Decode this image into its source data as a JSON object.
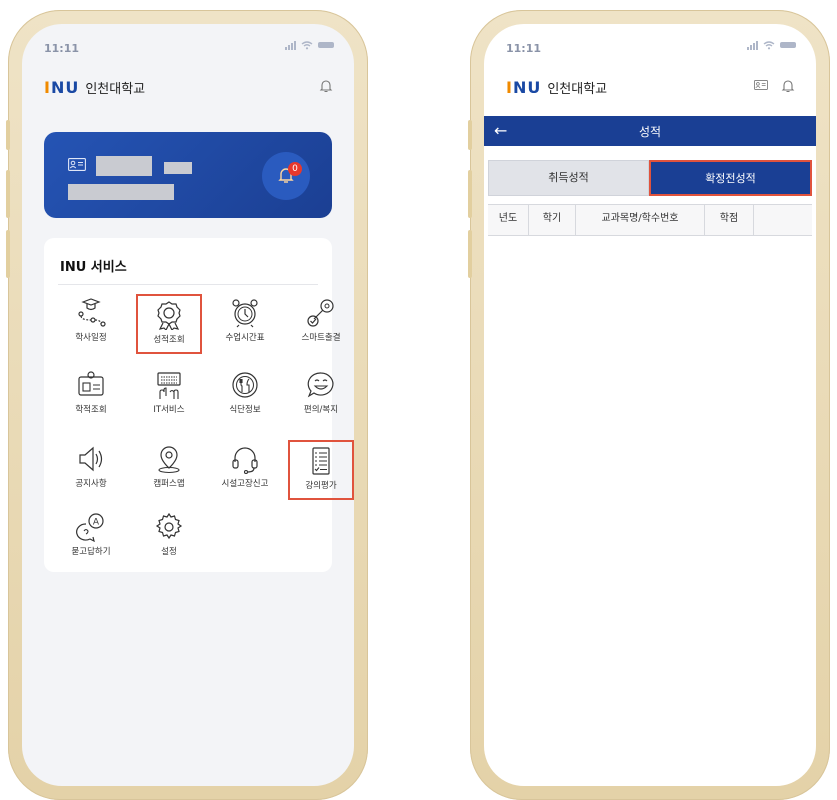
{
  "left_phone": {
    "status": {
      "time": "11:11"
    },
    "logo": {
      "mark_i": "I",
      "mark_n": "N",
      "mark_u": "U",
      "name": "인천대학교"
    },
    "card": {
      "badge_count": "0"
    },
    "services": {
      "title": "INU 서비스",
      "items": [
        {
          "label": "학사일정",
          "icon": "graduation-path-icon"
        },
        {
          "label": "성적조회",
          "icon": "ribbon-award-icon"
        },
        {
          "label": "수업시간표",
          "icon": "alarm-clock-icon"
        },
        {
          "label": "스마트출결",
          "icon": "key-check-icon"
        },
        {
          "label": "학적조회",
          "icon": "id-card-icon"
        },
        {
          "label": "IT서비스",
          "icon": "keyboard-icon"
        },
        {
          "label": "식단정보",
          "icon": "dining-icon"
        },
        {
          "label": "편의/복지",
          "icon": "smile-chat-icon"
        },
        {
          "label": "공지사항",
          "icon": "speaker-icon"
        },
        {
          "label": "캠퍼스맵",
          "icon": "map-pin-icon"
        },
        {
          "label": "시설고장신고",
          "icon": "headset-icon"
        },
        {
          "label": "강의평가",
          "icon": "checklist-icon"
        },
        {
          "label": "묻고답하기",
          "icon": "qa-bubble-icon"
        },
        {
          "label": "설정",
          "icon": "gear-icon"
        }
      ]
    }
  },
  "right_phone": {
    "status": {
      "time": "11:11"
    },
    "logo": {
      "mark_i": "I",
      "mark_n": "N",
      "mark_u": "U",
      "name": "인천대학교"
    },
    "topbar": {
      "back": "←",
      "title": "성적"
    },
    "tabs": [
      {
        "label": "취득성적",
        "active": false
      },
      {
        "label": "확정전성적",
        "active": true
      }
    ],
    "table_headers": [
      "년도",
      "학기",
      "교과목명/학수번호",
      "학점"
    ]
  },
  "colors": {
    "brand_blue": "#1a3f94",
    "highlight": "#e0533d",
    "logo_orange": "#f08a00",
    "logo_yellow": "#f0b400"
  }
}
